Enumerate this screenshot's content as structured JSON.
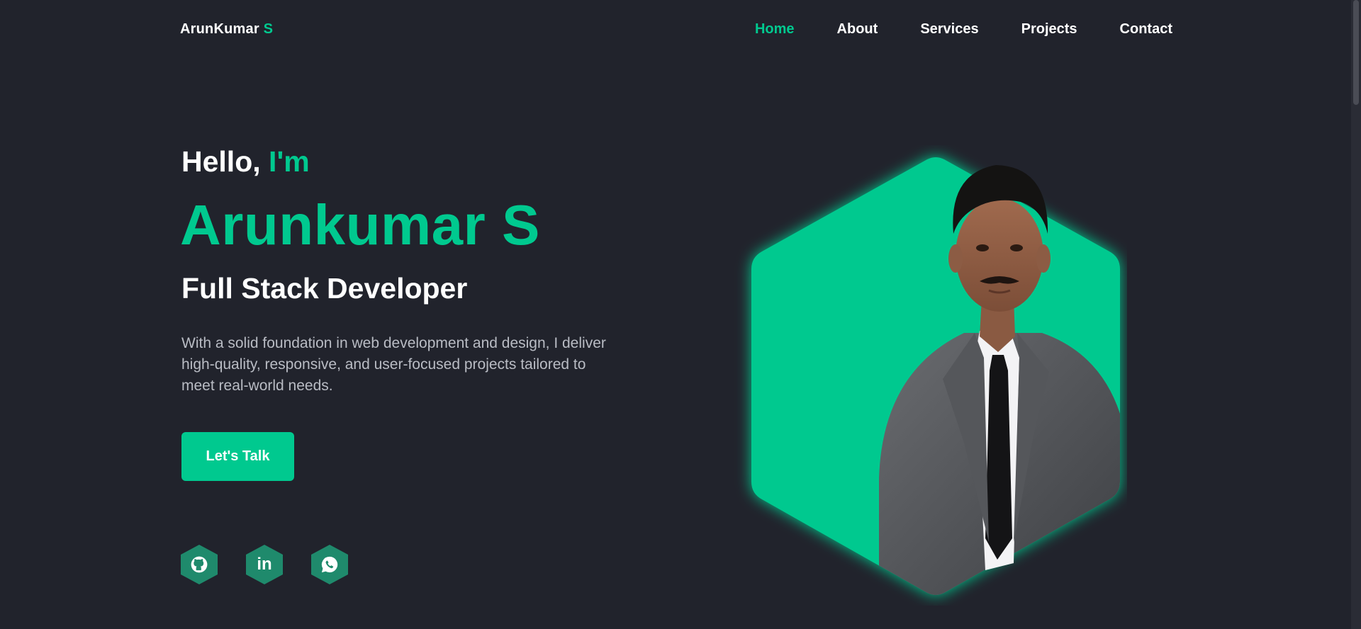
{
  "header": {
    "logo_main": "ArunKumar",
    "logo_accent": "S",
    "nav": [
      {
        "label": "Home"
      },
      {
        "label": "About"
      },
      {
        "label": "Services"
      },
      {
        "label": "Projects"
      },
      {
        "label": "Contact"
      }
    ],
    "active_nav": "Home"
  },
  "hero": {
    "greeting": "Hello,",
    "greeting_accent": "I'm",
    "name": "Arunkumar S",
    "role": "Full Stack Developer",
    "description": "With a solid foundation in web development and design, I deliver high-quality, responsive, and user-focused projects tailored to meet real-world needs.",
    "cta_label": "Let's Talk",
    "socials": [
      {
        "icon": "github-icon"
      },
      {
        "icon": "linkedin-icon",
        "glyph": "in"
      },
      {
        "icon": "whatsapp-icon"
      }
    ]
  },
  "colors": {
    "background": "#21232c",
    "accent": "#00c98f",
    "social_bg": "#1f8a6c",
    "text": "#ffffff",
    "muted_text": "#b9bcc4"
  }
}
